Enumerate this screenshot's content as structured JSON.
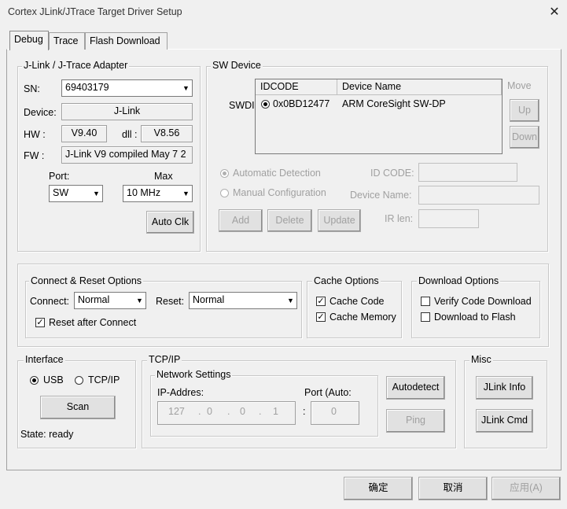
{
  "window": {
    "title": "Cortex JLink/JTrace Target Driver Setup",
    "close_symbol": "✕"
  },
  "tabs": [
    {
      "label": "Debug"
    },
    {
      "label": "Trace"
    },
    {
      "label": "Flash Download"
    }
  ],
  "adapter": {
    "legend": "J-Link / J-Trace Adapter",
    "sn_label": "SN:",
    "sn_value": "69403179",
    "device_label": "Device:",
    "device_value": "J-Link",
    "hw_label": "HW :",
    "hw_value": "V9.40",
    "dll_label": "dll :",
    "dll_value": "V8.56",
    "fw_label": "FW :",
    "fw_value": "J-Link V9 compiled May  7 2",
    "port_label": "Port:",
    "port_value": "SW",
    "max_label": "Max",
    "max_value": "10 MHz",
    "autoclk_label": "Auto Clk"
  },
  "sw_device": {
    "legend": "SW Device",
    "swdi_label": "SWDI",
    "col_idcode": "IDCODE",
    "col_device_name": "Device Name",
    "rows": [
      {
        "idcode": "0x0BD12477",
        "device_name": "ARM CoreSight SW-DP"
      }
    ],
    "move_label": "Move",
    "up_label": "Up",
    "down_label": "Down",
    "auto_detection": "Automatic Detection",
    "manual_config": "Manual Configuration",
    "id_code_label": "ID CODE:",
    "device_name_label": "Device Name:",
    "ir_len_label": "IR len:",
    "add_label": "Add",
    "delete_label": "Delete",
    "update_label": "Update"
  },
  "connect_reset": {
    "legend": "Connect & Reset Options",
    "connect_label": "Connect:",
    "connect_value": "Normal",
    "reset_label": "Reset:",
    "reset_value": "Normal",
    "reset_after_connect": "Reset after Connect"
  },
  "cache": {
    "legend": "Cache Options",
    "cache_code": "Cache Code",
    "cache_memory": "Cache Memory"
  },
  "download": {
    "legend": "Download Options",
    "verify": "Verify Code Download",
    "download_to_flash": "Download to Flash"
  },
  "interface": {
    "legend": "Interface",
    "usb": "USB",
    "tcpip": "TCP/IP",
    "scan_label": "Scan",
    "state": "State: ready"
  },
  "tcpip": {
    "legend": "TCP/IP",
    "network_legend": "Network Settings",
    "ip_label": "IP-Addres:",
    "port_label": "Port (Auto:",
    "ip": [
      "127",
      "0",
      "0",
      "1"
    ],
    "ip_sep": ".",
    "colon": ":",
    "port_value": "0",
    "autodetect_label": "Autodetect",
    "ping_label": "Ping"
  },
  "misc": {
    "legend": "Misc",
    "jlink_info": "JLink Info",
    "jlink_cmd": "JLink Cmd"
  },
  "footer": {
    "ok": "确定",
    "cancel": "取消",
    "apply": "应用(A)"
  }
}
